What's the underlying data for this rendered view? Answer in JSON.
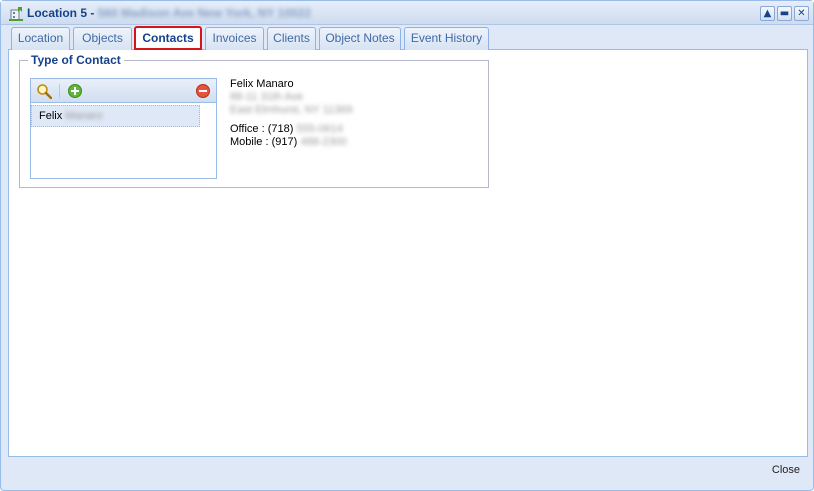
{
  "window": {
    "title": "Location 5 -",
    "title_address": "560 Madison Ave New York, NY 10022",
    "tools": {
      "up": "▲",
      "minimize": "▬",
      "close": "✕"
    }
  },
  "tabs": [
    {
      "label": "Location"
    },
    {
      "label": "Objects"
    },
    {
      "label": "Contacts",
      "active": true
    },
    {
      "label": "Invoices"
    },
    {
      "label": "Clients"
    },
    {
      "label": "Object Notes"
    },
    {
      "label": "Event History"
    }
  ],
  "contact_panel": {
    "legend": "Type of Contact",
    "toolbar": {
      "search_icon": "search-icon",
      "add_icon": "add-icon",
      "remove_icon": "remove-icon"
    },
    "list": [
      {
        "first": "Felix",
        "last": "Manaro"
      }
    ]
  },
  "contact_details": {
    "name": "Felix Manaro",
    "address1": "88-11 31th Ave",
    "address2": "East Elmhurst, NY 11369",
    "office_label": "Office : (718)",
    "office_rest": "555-0614",
    "mobile_label": "Mobile : (917)",
    "mobile_rest": "488-2300"
  },
  "footer": {
    "close_label": "Close"
  },
  "colors": {
    "accent": "#15428b",
    "tab_highlight": "#d7141a",
    "panel_bg": "#dfe8f6"
  }
}
